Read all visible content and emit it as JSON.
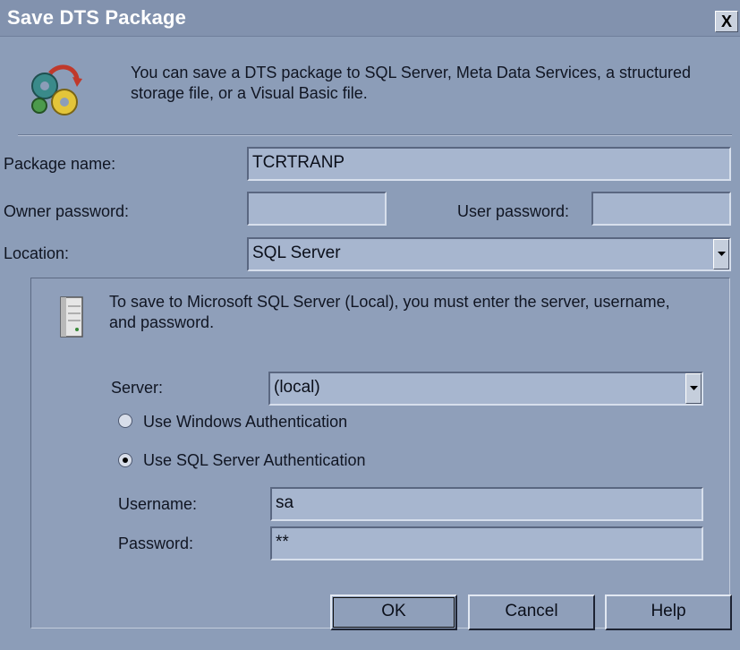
{
  "dialog": {
    "title": "Save DTS Package",
    "close_label": "X",
    "intro_text": "You can save a DTS package to SQL Server, Meta Data Services, a structured storage file, or a Visual Basic file."
  },
  "form": {
    "package_name_label": "Package name:",
    "package_name_value": "TCRTRANP",
    "owner_password_label": "Owner password:",
    "owner_password_value": "",
    "user_password_label": "User password:",
    "user_password_value": "",
    "location_label": "Location:",
    "location_value": "SQL Server"
  },
  "server_group": {
    "message": "To save to Microsoft SQL Server (Local), you must enter the server, username, and password.",
    "server_label": "Server:",
    "server_value": "(local)",
    "radio_windows_label": "Use Windows Authentication",
    "radio_sql_label": "Use SQL Server Authentication",
    "selected_auth": "sql",
    "username_label": "Username:",
    "username_value": "sa",
    "password_label": "Password:",
    "password_value": "**"
  },
  "buttons": {
    "ok": "OK",
    "cancel": "Cancel",
    "help": "Help"
  },
  "icons": [
    "package-gears-icon",
    "server-icon",
    "close-icon",
    "dropdown-arrow-icon"
  ],
  "colors": {
    "dialog_bg": "#8c9db8",
    "title_bg": "#8292ae",
    "field_bg": "#a7b6cf"
  }
}
